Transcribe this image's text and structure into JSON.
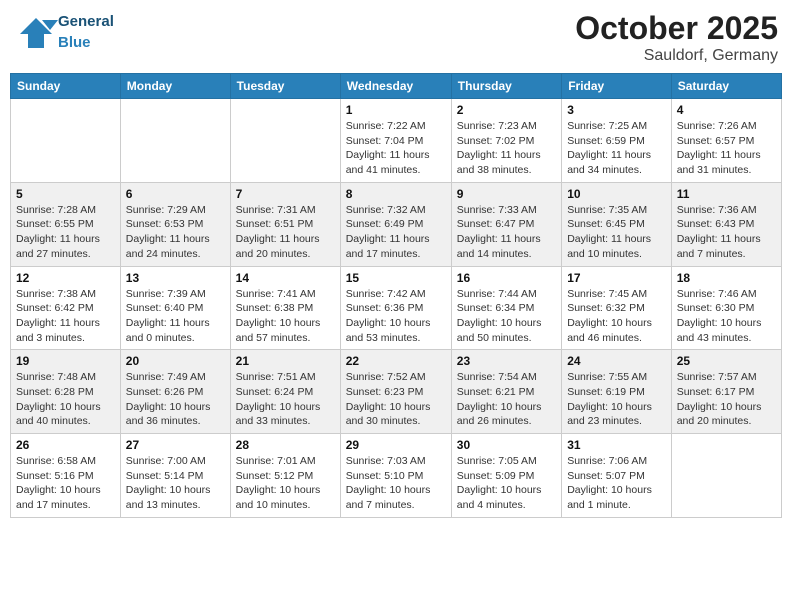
{
  "header": {
    "logo_general": "General",
    "logo_blue": "Blue",
    "month": "October 2025",
    "location": "Sauldorf, Germany"
  },
  "weekdays": [
    "Sunday",
    "Monday",
    "Tuesday",
    "Wednesday",
    "Thursday",
    "Friday",
    "Saturday"
  ],
  "weeks": [
    [
      {
        "day": "",
        "sunrise": "",
        "sunset": "",
        "daylight": ""
      },
      {
        "day": "",
        "sunrise": "",
        "sunset": "",
        "daylight": ""
      },
      {
        "day": "",
        "sunrise": "",
        "sunset": "",
        "daylight": ""
      },
      {
        "day": "1",
        "sunrise": "Sunrise: 7:22 AM",
        "sunset": "Sunset: 7:04 PM",
        "daylight": "Daylight: 11 hours and 41 minutes."
      },
      {
        "day": "2",
        "sunrise": "Sunrise: 7:23 AM",
        "sunset": "Sunset: 7:02 PM",
        "daylight": "Daylight: 11 hours and 38 minutes."
      },
      {
        "day": "3",
        "sunrise": "Sunrise: 7:25 AM",
        "sunset": "Sunset: 6:59 PM",
        "daylight": "Daylight: 11 hours and 34 minutes."
      },
      {
        "day": "4",
        "sunrise": "Sunrise: 7:26 AM",
        "sunset": "Sunset: 6:57 PM",
        "daylight": "Daylight: 11 hours and 31 minutes."
      }
    ],
    [
      {
        "day": "5",
        "sunrise": "Sunrise: 7:28 AM",
        "sunset": "Sunset: 6:55 PM",
        "daylight": "Daylight: 11 hours and 27 minutes."
      },
      {
        "day": "6",
        "sunrise": "Sunrise: 7:29 AM",
        "sunset": "Sunset: 6:53 PM",
        "daylight": "Daylight: 11 hours and 24 minutes."
      },
      {
        "day": "7",
        "sunrise": "Sunrise: 7:31 AM",
        "sunset": "Sunset: 6:51 PM",
        "daylight": "Daylight: 11 hours and 20 minutes."
      },
      {
        "day": "8",
        "sunrise": "Sunrise: 7:32 AM",
        "sunset": "Sunset: 6:49 PM",
        "daylight": "Daylight: 11 hours and 17 minutes."
      },
      {
        "day": "9",
        "sunrise": "Sunrise: 7:33 AM",
        "sunset": "Sunset: 6:47 PM",
        "daylight": "Daylight: 11 hours and 14 minutes."
      },
      {
        "day": "10",
        "sunrise": "Sunrise: 7:35 AM",
        "sunset": "Sunset: 6:45 PM",
        "daylight": "Daylight: 11 hours and 10 minutes."
      },
      {
        "day": "11",
        "sunrise": "Sunrise: 7:36 AM",
        "sunset": "Sunset: 6:43 PM",
        "daylight": "Daylight: 11 hours and 7 minutes."
      }
    ],
    [
      {
        "day": "12",
        "sunrise": "Sunrise: 7:38 AM",
        "sunset": "Sunset: 6:42 PM",
        "daylight": "Daylight: 11 hours and 3 minutes."
      },
      {
        "day": "13",
        "sunrise": "Sunrise: 7:39 AM",
        "sunset": "Sunset: 6:40 PM",
        "daylight": "Daylight: 11 hours and 0 minutes."
      },
      {
        "day": "14",
        "sunrise": "Sunrise: 7:41 AM",
        "sunset": "Sunset: 6:38 PM",
        "daylight": "Daylight: 10 hours and 57 minutes."
      },
      {
        "day": "15",
        "sunrise": "Sunrise: 7:42 AM",
        "sunset": "Sunset: 6:36 PM",
        "daylight": "Daylight: 10 hours and 53 minutes."
      },
      {
        "day": "16",
        "sunrise": "Sunrise: 7:44 AM",
        "sunset": "Sunset: 6:34 PM",
        "daylight": "Daylight: 10 hours and 50 minutes."
      },
      {
        "day": "17",
        "sunrise": "Sunrise: 7:45 AM",
        "sunset": "Sunset: 6:32 PM",
        "daylight": "Daylight: 10 hours and 46 minutes."
      },
      {
        "day": "18",
        "sunrise": "Sunrise: 7:46 AM",
        "sunset": "Sunset: 6:30 PM",
        "daylight": "Daylight: 10 hours and 43 minutes."
      }
    ],
    [
      {
        "day": "19",
        "sunrise": "Sunrise: 7:48 AM",
        "sunset": "Sunset: 6:28 PM",
        "daylight": "Daylight: 10 hours and 40 minutes."
      },
      {
        "day": "20",
        "sunrise": "Sunrise: 7:49 AM",
        "sunset": "Sunset: 6:26 PM",
        "daylight": "Daylight: 10 hours and 36 minutes."
      },
      {
        "day": "21",
        "sunrise": "Sunrise: 7:51 AM",
        "sunset": "Sunset: 6:24 PM",
        "daylight": "Daylight: 10 hours and 33 minutes."
      },
      {
        "day": "22",
        "sunrise": "Sunrise: 7:52 AM",
        "sunset": "Sunset: 6:23 PM",
        "daylight": "Daylight: 10 hours and 30 minutes."
      },
      {
        "day": "23",
        "sunrise": "Sunrise: 7:54 AM",
        "sunset": "Sunset: 6:21 PM",
        "daylight": "Daylight: 10 hours and 26 minutes."
      },
      {
        "day": "24",
        "sunrise": "Sunrise: 7:55 AM",
        "sunset": "Sunset: 6:19 PM",
        "daylight": "Daylight: 10 hours and 23 minutes."
      },
      {
        "day": "25",
        "sunrise": "Sunrise: 7:57 AM",
        "sunset": "Sunset: 6:17 PM",
        "daylight": "Daylight: 10 hours and 20 minutes."
      }
    ],
    [
      {
        "day": "26",
        "sunrise": "Sunrise: 6:58 AM",
        "sunset": "Sunset: 5:16 PM",
        "daylight": "Daylight: 10 hours and 17 minutes."
      },
      {
        "day": "27",
        "sunrise": "Sunrise: 7:00 AM",
        "sunset": "Sunset: 5:14 PM",
        "daylight": "Daylight: 10 hours and 13 minutes."
      },
      {
        "day": "28",
        "sunrise": "Sunrise: 7:01 AM",
        "sunset": "Sunset: 5:12 PM",
        "daylight": "Daylight: 10 hours and 10 minutes."
      },
      {
        "day": "29",
        "sunrise": "Sunrise: 7:03 AM",
        "sunset": "Sunset: 5:10 PM",
        "daylight": "Daylight: 10 hours and 7 minutes."
      },
      {
        "day": "30",
        "sunrise": "Sunrise: 7:05 AM",
        "sunset": "Sunset: 5:09 PM",
        "daylight": "Daylight: 10 hours and 4 minutes."
      },
      {
        "day": "31",
        "sunrise": "Sunrise: 7:06 AM",
        "sunset": "Sunset: 5:07 PM",
        "daylight": "Daylight: 10 hours and 1 minute."
      },
      {
        "day": "",
        "sunrise": "",
        "sunset": "",
        "daylight": ""
      }
    ]
  ]
}
